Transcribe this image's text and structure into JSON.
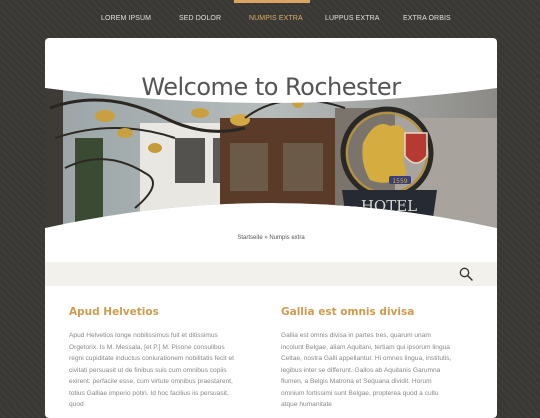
{
  "nav": {
    "items": [
      {
        "label": "LOREM IPSUM"
      },
      {
        "label": "SED DOLOR"
      },
      {
        "label": "NUMPIS EXTRA"
      },
      {
        "label": "LUPPUS EXTRA"
      },
      {
        "label": "EXTRA ORBIS"
      }
    ],
    "active_index": 2
  },
  "page": {
    "title": "Welcome to Rochester",
    "breadcrumb": "Startseite » Numpis extra"
  },
  "hero": {
    "sign_text": "HOTEL",
    "sign_year": "1559"
  },
  "columns": [
    {
      "heading": "Apud Helvetios",
      "text": "Apud Helvetios longe nobilissimus fuit et ditissimus Orgetorix. Is M. Messala, [et P.] M. Pisone consulibus regni cupiditate inductus coniurationem nobilitatis fecit et civitati persuasit ut de finibus suis cum omnibus copiis exirent: perfacile esse, cum virtute omnibus praestarent, totius Galliae imperio potiri. Id hoc facilius iis persuasit, quod"
    },
    {
      "heading": "Gallia est omnis divisa",
      "text": "Gallia est omnis divisa in partes tres, quarum unam incolunt Belgae, aliam Aquitani, tertiam qui ipsorum lingua Celtae, nostra Galli appellantur. Hi omnes lingua, institutis, legibus inter se differunt. Gallos ab Aquitanis Garumna flumen, a Belgis Matrona et Sequana dividit. Horum omnium fortissimi sunt Belgae, propterea quod a cultu atque humanitate"
    }
  ],
  "colors": {
    "accent": "#d9a561",
    "heading": "#d09a50",
    "background": "#3a3835",
    "search_bar": "#f3f1eb"
  },
  "icons": {
    "search": "search-icon"
  }
}
